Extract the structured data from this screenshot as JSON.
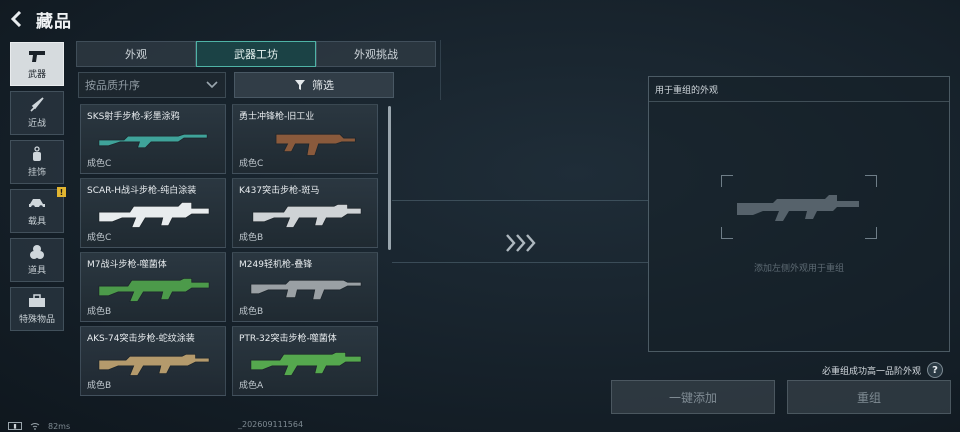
{
  "header": {
    "title": "藏品"
  },
  "rail": [
    {
      "label": "武器",
      "icon": "pistol-icon",
      "active": true
    },
    {
      "label": "近战",
      "icon": "knife-icon",
      "active": false
    },
    {
      "label": "挂饰",
      "icon": "charm-icon",
      "active": false
    },
    {
      "label": "载具",
      "icon": "vehicle-icon",
      "active": false,
      "badge": "!"
    },
    {
      "label": "道具",
      "icon": "grenade-icon",
      "active": false
    },
    {
      "label": "特殊物品",
      "icon": "briefcase-icon",
      "active": false
    }
  ],
  "tabs": [
    {
      "label": "外观",
      "active": false
    },
    {
      "label": "武器工坊",
      "active": true
    },
    {
      "label": "外观挑战",
      "active": false
    }
  ],
  "sort": {
    "label": "按品质升序"
  },
  "filter": {
    "label": "筛选"
  },
  "skins": [
    {
      "name": "SKS射手步枪-彩墨涂鸦",
      "grade": "成色C",
      "color": "#3fa39a"
    },
    {
      "name": "勇士冲锋枪-旧工业",
      "grade": "成色C",
      "color": "#8a5a3c"
    },
    {
      "name": "SCAR-H战斗步枪-纯白涂装",
      "grade": "成色C",
      "color": "#e8ecee"
    },
    {
      "name": "K437突击步枪-斑马",
      "grade": "成色B",
      "color": "#cfd3d6"
    },
    {
      "name": "M7战斗步枪-噬菌体",
      "grade": "成色B",
      "color": "#4c9a4a"
    },
    {
      "name": "M249轻机枪-叠锋",
      "grade": "成色B",
      "color": "#9aa0a4"
    },
    {
      "name": "AKS-74突击步枪-蛇纹涂装",
      "grade": "成色B",
      "color": "#b49a6c"
    },
    {
      "name": "PTR-32突击步枪-噬菌体",
      "grade": "成色A",
      "color": "#55a84e"
    }
  ],
  "recombine": {
    "title": "用于重组的外观",
    "hint": "添加左侧外观用于重组",
    "requirement": "必重组成功高一品阶外观",
    "help": "?"
  },
  "actions": {
    "quick_add": "一键添加",
    "recombine": "重组"
  },
  "status": {
    "ping": "82ms",
    "build": "_202609111564"
  },
  "colors": {
    "accent": "#4fb3a6",
    "badge": "#e2b531"
  }
}
